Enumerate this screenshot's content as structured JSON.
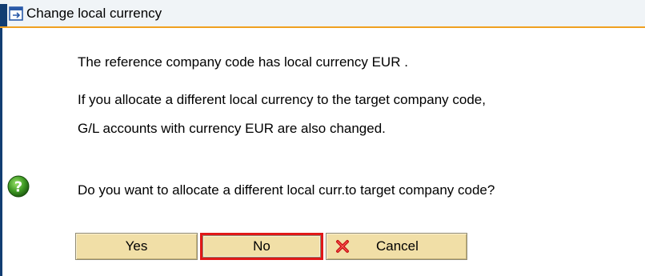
{
  "dialog": {
    "title": "Change local currency",
    "title_icon": "window-arrow-icon"
  },
  "message": {
    "line1": "The reference company code has local currency EUR .",
    "line2": "If you allocate a different local currency to the target company code,",
    "line3": "G/L accounts with currency EUR are also changed."
  },
  "question": {
    "icon": "question-icon",
    "text": "Do you want to allocate a different local curr.to target company code?"
  },
  "buttons": {
    "yes_label": "Yes",
    "no_label": "No",
    "cancel_label": "Cancel",
    "cancel_icon": "cancel-x-icon"
  },
  "colors": {
    "accent_orange": "#f0a020",
    "frame_navy": "#123d72",
    "button_fill": "#f1dfa7",
    "focus_red": "#e01818",
    "question_green": "#2e8b1f",
    "cancel_red": "#c81414"
  }
}
